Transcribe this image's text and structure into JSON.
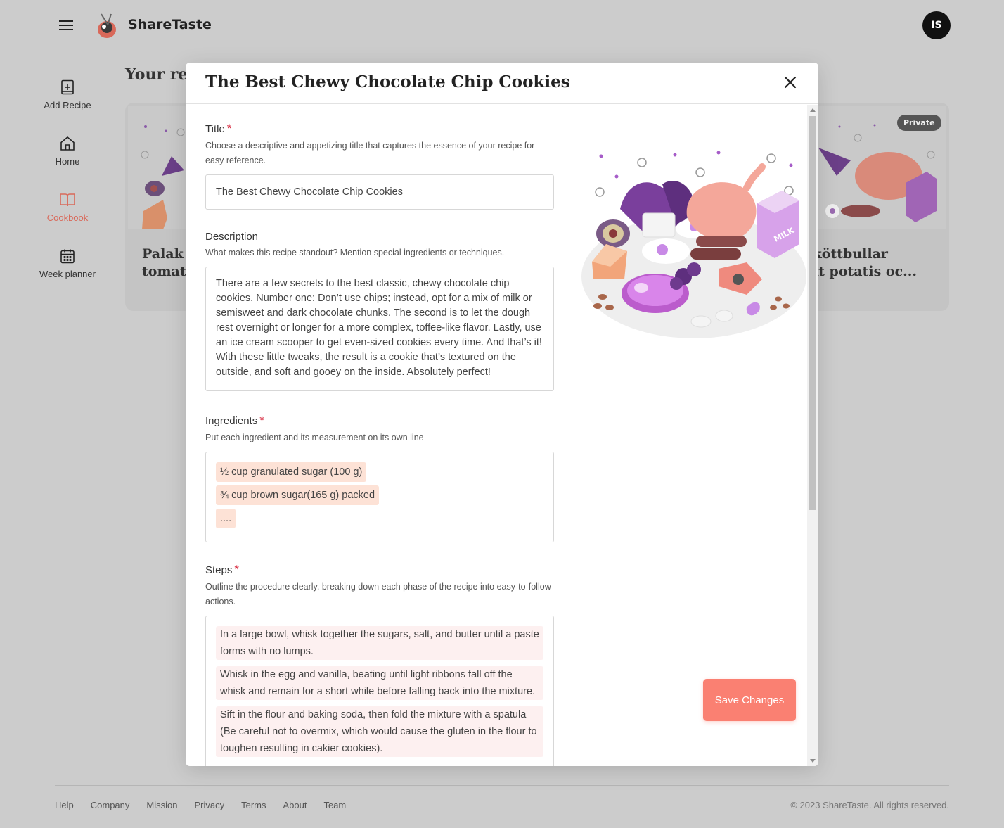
{
  "app": {
    "brand": "ShareTaste",
    "avatar_initials": "IS"
  },
  "sidebar": {
    "items": [
      {
        "label": "Add Recipe",
        "icon": "add-recipe-icon"
      },
      {
        "label": "Home",
        "icon": "home-icon"
      },
      {
        "label": "Cookbook",
        "icon": "book-icon",
        "active": true
      },
      {
        "label": "Week planner",
        "icon": "calendar-icon"
      }
    ]
  },
  "page": {
    "heading": "Your re",
    "cards": [
      {
        "title_line1": "Palak p",
        "title_line2": "tomat"
      },
      {
        "title_line1": "s köttbullar",
        "title_line2": "okt potatis oc...",
        "badge": "Private"
      }
    ]
  },
  "modal": {
    "title": "The Best Chewy Chocolate Chip Cookies",
    "title_field": {
      "label": "Title",
      "help": "Choose a descriptive and appetizing title that captures the essence of your recipe for easy reference.",
      "value": "The Best Chewy Chocolate Chip Cookies"
    },
    "description_field": {
      "label": "Description",
      "help": "What makes this recipe standout? Mention special ingredients or techniques.",
      "value": "There are a few secrets to the best classic, chewy chocolate chip cookies. Number one: Don’t use chips; instead, opt for a mix of milk or semisweet and dark chocolate chunks. The second is to let the dough rest overnight or longer for a more complex, toffee-like flavor. Lastly, use an ice cream scooper to get even-sized cookies every time. And that’s it! With these little tweaks, the result is a cookie that’s textured on the outside, and soft and gooey on the inside. Absolutely perfect!"
    },
    "ingredients_field": {
      "label": "Ingredients",
      "help": "Put each ingredient and its measurement on its own line",
      "items": [
        "½ cup granulated sugar (100 g)",
        "¾ cup brown sugar(165 g) packed",
        "...."
      ]
    },
    "steps_field": {
      "label": "Steps",
      "help": "Outline the procedure clearly, breaking down each phase of the recipe into easy-to-follow actions.",
      "items": [
        "In a large bowl, whisk together the sugars, salt, and butter until a paste forms with no lumps.",
        "Whisk in the egg and vanilla, beating until light ribbons fall off the whisk and remain for a short while before falling back into the mixture.",
        "Sift in the flour and baking soda, then fold the mixture with a spatula (Be careful not to overmix, which would cause the gluten in the flour to toughen resulting in cakier cookies)."
      ]
    },
    "required_mark": "*",
    "save_label": "Save Changes"
  },
  "footer": {
    "links": [
      "Help",
      "Company",
      "Mission",
      "Privacy",
      "Terms",
      "About",
      "Team"
    ],
    "copyright": "© 2023 ShareTaste. All rights reserved."
  },
  "colors": {
    "accent": "#fa8072",
    "active_nav": "#d9695a",
    "chip": "#fde2d6",
    "required": "#d93045"
  }
}
